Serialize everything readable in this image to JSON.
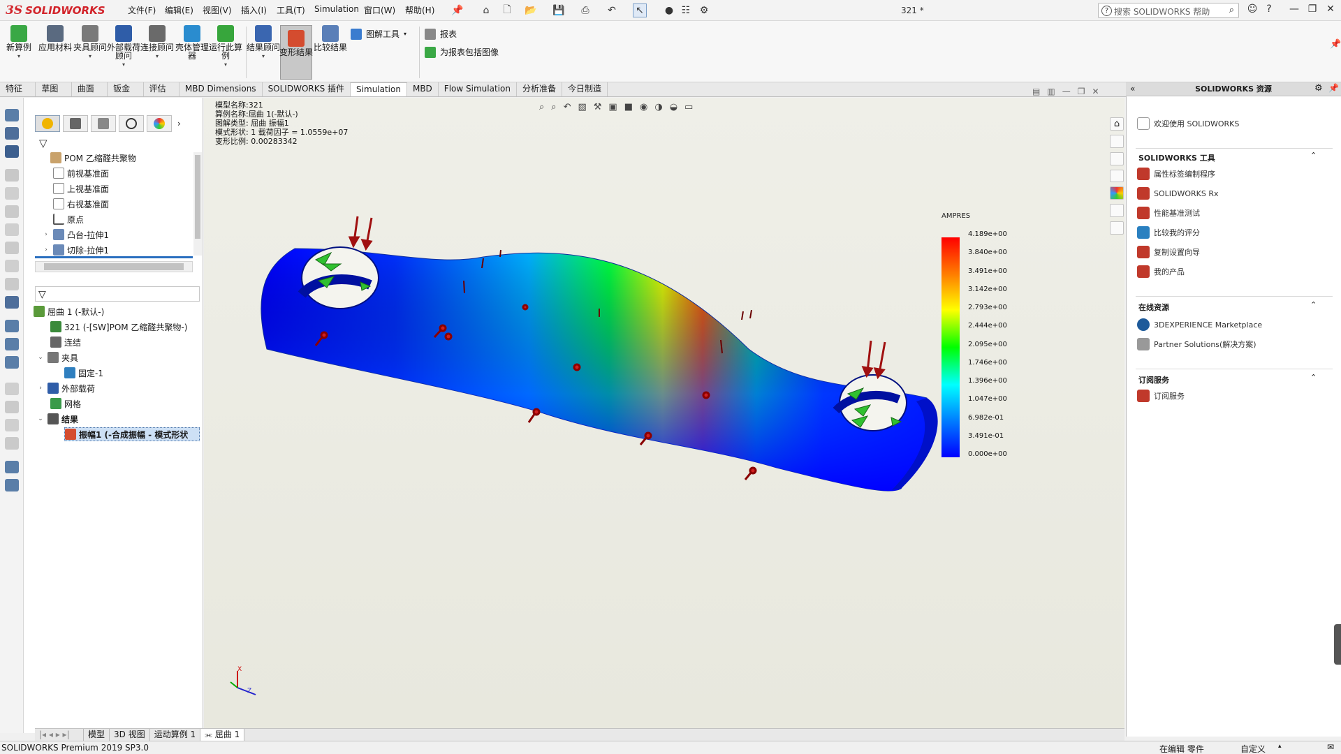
{
  "app": {
    "logo_prefix": "3S",
    "logo_text": "SOLIDWORKS",
    "document_name": "321 *"
  },
  "menu": [
    "文件(F)",
    "编辑(E)",
    "视图(V)",
    "插入(I)",
    "工具(T)",
    "Simulation",
    "窗口(W)",
    "帮助(H)"
  ],
  "help_search": {
    "placeholder": "搜索 SOLIDWORKS 帮助"
  },
  "command_manager": {
    "buttons": [
      {
        "label": "新算例",
        "color": "#3aa845"
      },
      {
        "label": "应用材料",
        "color": "#5a6a80"
      },
      {
        "label": "夹具顾问",
        "color": "#7a7a7a"
      },
      {
        "label": "外部载荷顾问",
        "color": "#2f5da8"
      },
      {
        "label": "连接顾问",
        "color": "#6a6a6a"
      },
      {
        "label": "壳体管理器",
        "color": "#2a8ccf"
      },
      {
        "label": "运行此算例",
        "color": "#37a63c"
      },
      {
        "label": "结果顾问",
        "color": "#3a66b0"
      },
      {
        "label": "变形结果",
        "color": "#d44c2f"
      },
      {
        "label": "比较结果",
        "color": "#5a7fb8"
      }
    ],
    "side_items": [
      {
        "label": "图解工具",
        "color": "#3a7ccf"
      },
      {
        "label": "报表",
        "color": "#888"
      },
      {
        "label": "为报表包括图像",
        "color": "#3aa845"
      }
    ]
  },
  "tabs": [
    "特征",
    "草图",
    "曲面",
    "钣金",
    "评估",
    "MBD Dimensions",
    "SOLIDWORKS 插件",
    "Simulation",
    "MBD",
    "Flow Simulation",
    "分析准备",
    "今日制造"
  ],
  "active_tab": "Simulation",
  "feature_tree_top": [
    {
      "label": "POM 乙缩醛共聚物",
      "color": "#c9a26b"
    },
    {
      "label": "前视基准面",
      "color": "#999"
    },
    {
      "label": "上视基准面",
      "color": "#999"
    },
    {
      "label": "右视基准面",
      "color": "#999"
    },
    {
      "label": "原点",
      "color": "#555"
    },
    {
      "label": "凸台-拉伸1",
      "color": "#6b8ab8"
    },
    {
      "label": "切除-拉伸1",
      "color": "#6b8ab8"
    }
  ],
  "sim_tree": [
    {
      "label": "屈曲 1 (-默认-)",
      "color": "#5a9a3a"
    },
    {
      "label": "321 (-[SW]POM 乙缩醛共聚物-)",
      "color": "#3a8a3a"
    },
    {
      "label": "连结",
      "color": "#666"
    },
    {
      "label": "夹具",
      "color": "#666"
    },
    {
      "label": "固定-1",
      "color": "#2f7fbf"
    },
    {
      "label": "外部载荷",
      "color": "#2f5da8"
    },
    {
      "label": "网格",
      "color": "#3a9a4a"
    },
    {
      "label": "结果",
      "color": "#555"
    },
    {
      "label": "振幅1 (-合成振幅 - 模式形状",
      "color": "#d44c2f"
    }
  ],
  "plot_info": [
    "模型名称:321",
    "算例名称:屈曲 1(-默认-)",
    "图解类型: 屈曲 振幅1",
    "模式形状: 1  载荷因子 = 1.0559e+07",
    "变形比例: 0.00283342"
  ],
  "legend": {
    "title": "AMPRES",
    "ticks": [
      "4.189e+00",
      "3.840e+00",
      "3.491e+00",
      "3.142e+00",
      "2.793e+00",
      "2.444e+00",
      "2.095e+00",
      "1.746e+00",
      "1.396e+00",
      "1.047e+00",
      "6.982e-01",
      "3.491e-01",
      "0.000e+00"
    ]
  },
  "bottom_tabs": [
    "模型",
    "3D 视图",
    "运动算例 1",
    "屈曲 1"
  ],
  "active_bottom_tab": "屈曲 1",
  "task_pane": {
    "title": "SOLIDWORKS 资源",
    "welcome": "欢迎使用 SOLIDWORKS",
    "sections": [
      {
        "title": "SOLIDWORKS 工具",
        "items": [
          {
            "label": "属性标签编制程序",
            "color": "#c0392b"
          },
          {
            "label": "SOLIDWORKS Rx",
            "color": "#c0392b"
          },
          {
            "label": "性能基准测试",
            "color": "#c0392b"
          },
          {
            "label": "比较我的评分",
            "color": "#2a80c0"
          },
          {
            "label": "复制设置向导",
            "color": "#c0392b"
          },
          {
            "label": "我的产品",
            "color": "#c0392b"
          }
        ]
      },
      {
        "title": "在线资源",
        "items": [
          {
            "label": "3DEXPERIENCE Marketplace",
            "color": "#1e5a9a"
          },
          {
            "label": "Partner Solutions(解决方案)",
            "color": "#777"
          }
        ]
      },
      {
        "title": "订阅服务",
        "items": [
          {
            "label": "订阅服务",
            "color": "#c0392b"
          }
        ]
      }
    ]
  },
  "status": {
    "left": "SOLIDWORKS Premium 2019 SP3.0",
    "editing": "在编辑 零件",
    "custom": "自定义"
  }
}
